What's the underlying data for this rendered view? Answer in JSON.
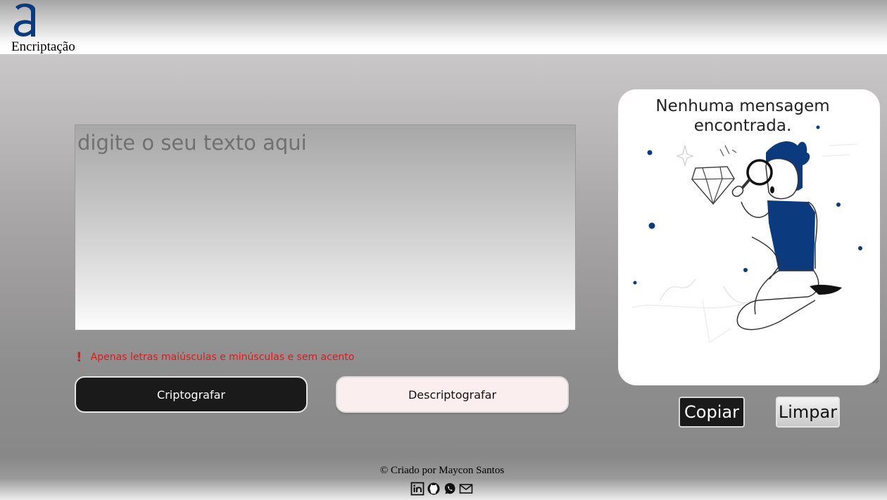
{
  "header": {
    "logo_icon": "alura-a-logo",
    "brand": "Encriptação"
  },
  "input": {
    "placeholder": "digite o seu texto aqui",
    "value": ""
  },
  "warning": {
    "icon": "exclamation-icon",
    "text": "Apenas letras maiúsculas e minúsculas e sem acento"
  },
  "actions": {
    "encrypt_label": "Criptografar",
    "decrypt_label": "Descriptografar"
  },
  "output": {
    "empty_title": "Nenhuma mensagem encontrada.",
    "illustration": "person-with-magnifier-and-diamond",
    "copy_label": "Copiar",
    "clear_label": "Limpar"
  },
  "footer": {
    "credit": "© Criado por Maycon Santos",
    "icons": [
      "linkedin-icon",
      "github-icon",
      "whatsapp-icon",
      "mail-icon"
    ]
  },
  "colors": {
    "accent_blue": "#0b3a7e",
    "warning_red": "#e01818",
    "dark_button": "#1b1a1a",
    "light_button": "#faeeee"
  }
}
